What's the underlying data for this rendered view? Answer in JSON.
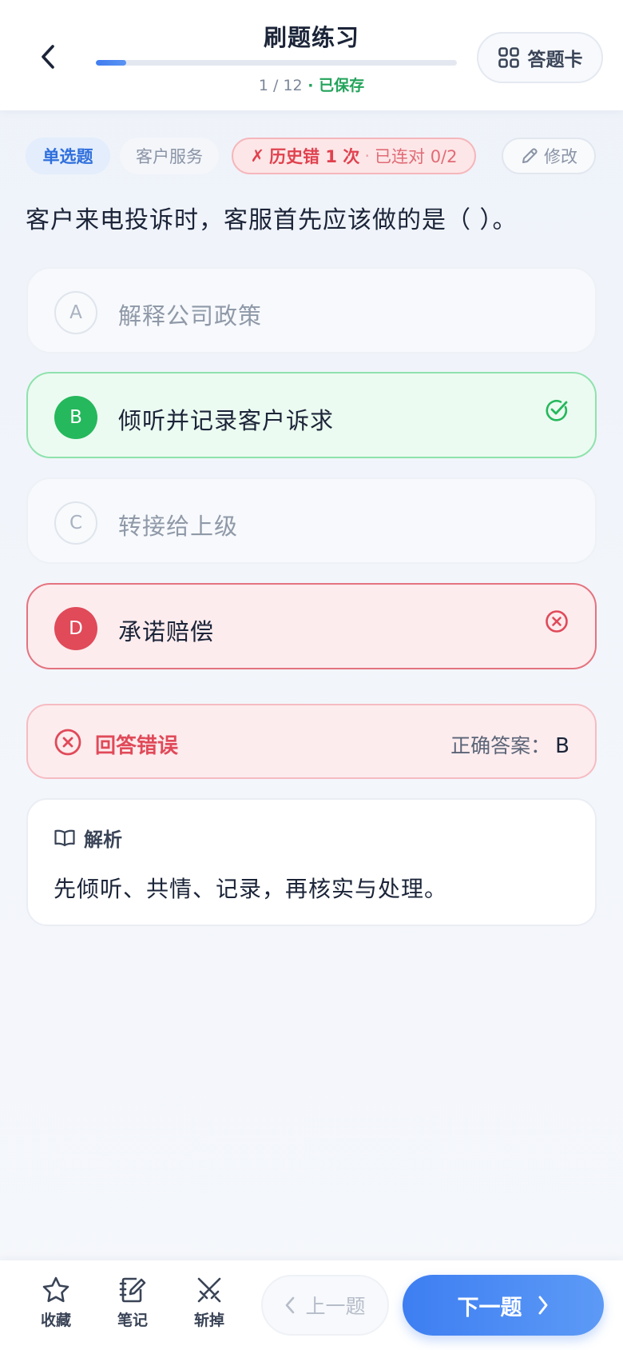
{
  "header": {
    "title": "刷题练习",
    "progress_text": "1 / 12",
    "progress_sep": " · ",
    "saved_text": "已保存",
    "progress_fraction": 0.0833,
    "answer_card_label": "答题卡"
  },
  "tags": {
    "type": "单选题",
    "category": "客户服务",
    "history_mark": "✗",
    "history_wrong": "历史错 1 次",
    "history_dot": "·",
    "history_streak": "已连对 0/2",
    "edit_label": "修改"
  },
  "question": {
    "text": "客户来电投诉时，客服首先应该做的是（ ）。",
    "options": [
      {
        "letter": "A",
        "text": "解释公司政策",
        "state": "neutral"
      },
      {
        "letter": "B",
        "text": "倾听并记录客户诉求",
        "state": "correct"
      },
      {
        "letter": "C",
        "text": "转接给上级",
        "state": "neutral"
      },
      {
        "letter": "D",
        "text": "承诺赔偿",
        "state": "wrong"
      }
    ]
  },
  "result": {
    "label": "回答错误",
    "answer_prefix": "正确答案：",
    "answer_value": "B"
  },
  "analysis": {
    "heading": "解析",
    "body": "先倾听、共情、记录，再核实与处理。"
  },
  "bottom": {
    "favorite_label": "收藏",
    "note_label": "笔记",
    "remove_label": "斩掉",
    "prev_label": "上一题",
    "next_label": "下一题"
  },
  "colors": {
    "accent": "#3d7ef2",
    "correct": "#25b85c",
    "wrong": "#e04a59",
    "saved": "#22a35a"
  },
  "icons": {
    "back": "chevron-left-icon",
    "answer_card": "grid-icon",
    "edit": "pencil-icon",
    "correct": "check-circle-icon",
    "wrong": "x-circle-icon",
    "analysis": "book-open-icon",
    "favorite": "star-icon",
    "note": "notebook-edit-icon",
    "remove": "crossed-swords-icon",
    "prev": "chevron-left-icon",
    "next": "chevron-right-icon"
  }
}
